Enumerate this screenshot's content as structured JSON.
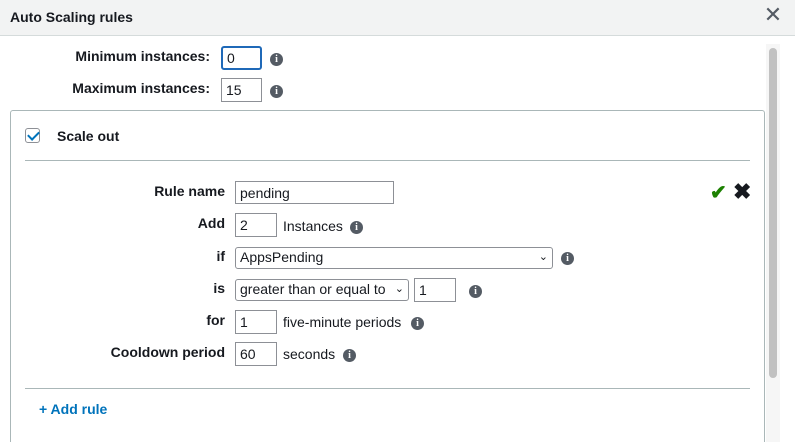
{
  "dialog": {
    "title": "Auto Scaling rules",
    "close_icon": "close-icon"
  },
  "limits": {
    "min_label": "Minimum instances:",
    "min_value": "0",
    "max_label": "Maximum instances:",
    "max_value": "15"
  },
  "scale_out": {
    "checked": true,
    "label": "Scale out"
  },
  "rule": {
    "name_label": "Rule name",
    "name_value": "pending",
    "add_label": "Add",
    "add_value": "2",
    "add_unit": "Instances",
    "if_label": "if",
    "if_value": "AppsPending",
    "is_label": "is",
    "is_operator": "greater than or equal to",
    "is_value": "1",
    "for_label": "for",
    "for_value": "1",
    "for_unit": "five-minute periods",
    "cooldown_label": "Cooldown period",
    "cooldown_value": "60",
    "cooldown_unit": "seconds"
  },
  "add_rule_label": "+ Add rule",
  "colors": {
    "accent": "#0073bb",
    "confirm": "#1d8102",
    "header_bg": "#f2f3f3"
  }
}
